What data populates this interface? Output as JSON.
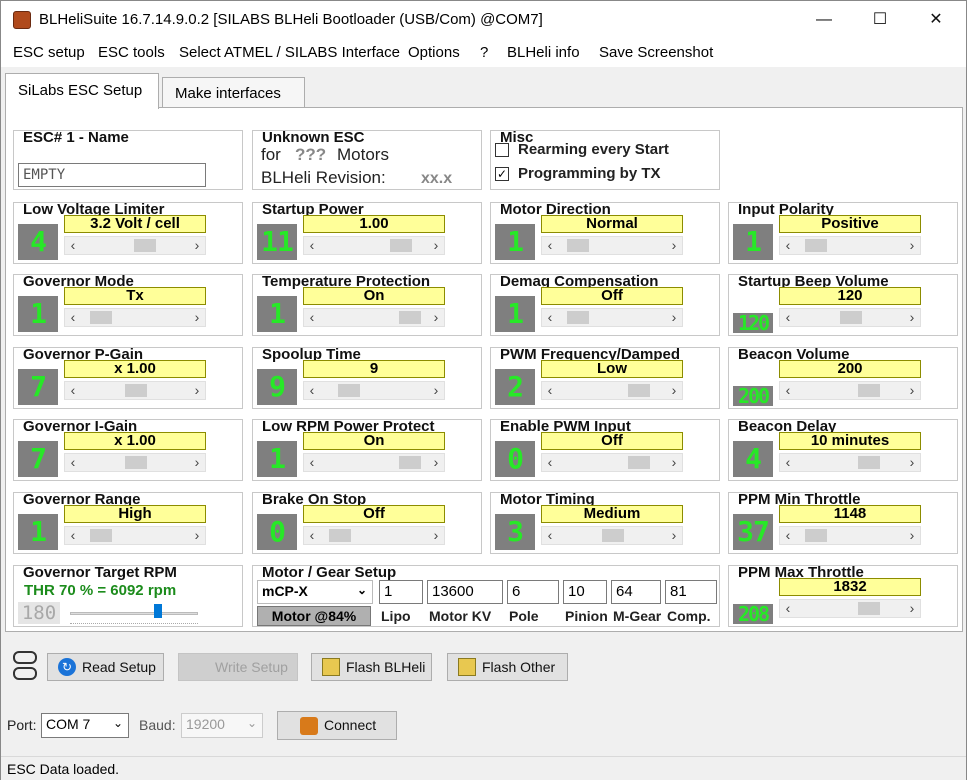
{
  "window": {
    "title": "BLHeliSuite 16.7.14.9.0.2  [SILABS BLHeli Bootloader (USB/Com) @COM7]",
    "minimize": "—",
    "maximize": "☐",
    "close": "✕"
  },
  "menu": [
    "ESC setup",
    "ESC tools",
    "Select ATMEL / SILABS Interface",
    "Options",
    "?",
    "BLHeli info",
    "Save Screenshot"
  ],
  "tabs": [
    "SiLabs ESC Setup",
    "Make interfaces"
  ],
  "esc_name": {
    "title": "ESC# 1 - Name",
    "value": "EMPTY"
  },
  "unknown_esc": {
    "title": "Unknown ESC",
    "line1a": "for",
    "line1b": "???",
    "line1c": "Motors",
    "line2a": "BLHeli Revision:",
    "line2b": "xx.x"
  },
  "misc": {
    "title": "Misc",
    "rearming": "Rearming every Start",
    "rearming_checked": false,
    "programming": "Programming by TX",
    "programming_checked": true
  },
  "params": [
    {
      "title": "Low Voltage Limiter",
      "num": "4",
      "value": "3.2 Volt / cell",
      "level": 0.6
    },
    {
      "title": "Startup Power",
      "num": "11",
      "value": "1.00",
      "level": 0.8
    },
    {
      "title": "Motor Direction",
      "num": "1",
      "value": "Normal",
      "level": 0.1
    },
    {
      "title": "Input Polarity",
      "num": "1",
      "value": "Positive",
      "level": 0.1
    },
    {
      "title": "Governor Mode",
      "num": "1",
      "value": "Tx",
      "level": 0.1
    },
    {
      "title": "Temperature Protection",
      "num": "1",
      "value": "On",
      "level": 0.9
    },
    {
      "title": "Demag Compensation",
      "num": "1",
      "value": "Off",
      "level": 0.1
    },
    {
      "title": "Startup Beep Volume",
      "num": "120",
      "value": "120",
      "level": 0.5
    },
    {
      "title": "Governor P-Gain",
      "num": "7",
      "value": "x 1.00",
      "level": 0.5
    },
    {
      "title": "Spoolup Time",
      "num": "9",
      "value": "9",
      "level": 0.2
    },
    {
      "title": "PWM Frequency/Damped",
      "num": "2",
      "value": "Low",
      "level": 0.8
    },
    {
      "title": "Beacon Volume",
      "num": "200",
      "value": "200",
      "level": 0.7
    },
    {
      "title": "Governor I-Gain",
      "num": "7",
      "value": "x 1.00",
      "level": 0.5
    },
    {
      "title": "Low RPM Power Protect",
      "num": "1",
      "value": "On",
      "level": 0.9
    },
    {
      "title": "Enable PWM Input",
      "num": "0",
      "value": "Off",
      "level": 0.8
    },
    {
      "title": "Beacon Delay",
      "num": "4",
      "value": "10 minutes",
      "level": 0.7
    },
    {
      "title": "Governor Range",
      "num": "1",
      "value": "High",
      "level": 0.1
    },
    {
      "title": "Brake On Stop",
      "num": "0",
      "value": "Off",
      "level": 0.1
    },
    {
      "title": "Motor Timing",
      "num": "3",
      "value": "Medium",
      "level": 0.5
    },
    {
      "title": "PPM Min Throttle",
      "num": "37",
      "value": "1148",
      "level": 0.1
    },
    {
      "title": "PPM Max Throttle",
      "num": "208",
      "value": "1832",
      "level": 0.7
    }
  ],
  "target_rpm": {
    "title": "Governor Target RPM",
    "text": "THR 70 % = 6092 rpm",
    "num": "180",
    "level": 0.7
  },
  "motor_gear": {
    "title": "Motor / Gear Setup",
    "model": "mCP-X",
    "motor_btn": "Motor @84%",
    "fields": [
      {
        "value": "1",
        "label": "Lipo"
      },
      {
        "value": "13600",
        "label": "Motor KV"
      },
      {
        "value": "6",
        "label": "Pole"
      },
      {
        "value": "10",
        "label": "Pinion"
      },
      {
        "value": "64",
        "label": "M-Gear"
      },
      {
        "value": "81",
        "label": "Comp."
      }
    ]
  },
  "buttons": {
    "read": "Read Setup",
    "write": "Write Setup",
    "flash": "Flash BLHeli",
    "other": "Flash Other"
  },
  "port": {
    "port_label": "Port:",
    "port_value": "COM 7",
    "baud_label": "Baud:",
    "baud_value": "19200",
    "connect": "Connect"
  },
  "status": "ESC Data loaded."
}
